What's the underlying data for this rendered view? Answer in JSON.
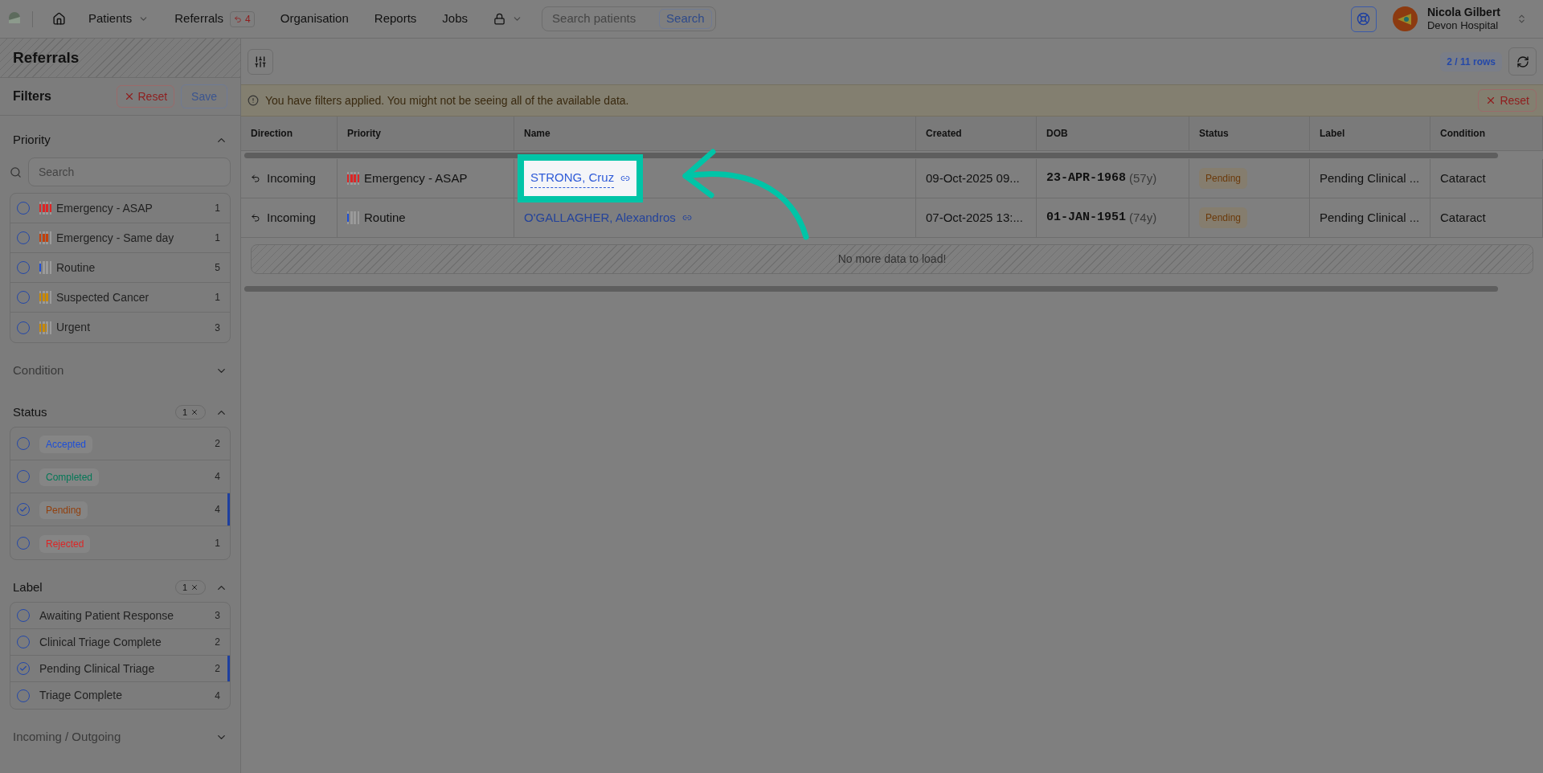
{
  "nav": {
    "items": [
      {
        "kind": "home"
      },
      {
        "kind": "dropdown",
        "label": "Patients"
      },
      {
        "kind": "badge",
        "label": "Referrals",
        "badge": "4"
      },
      {
        "kind": "link",
        "label": "Organisation"
      },
      {
        "kind": "link",
        "label": "Reports"
      },
      {
        "kind": "link",
        "label": "Jobs"
      },
      {
        "kind": "lock"
      }
    ],
    "search": {
      "placeholder": "Search patients",
      "button": "Search"
    },
    "user": {
      "name": "Nicola Gilbert",
      "org": "Devon Hospital"
    }
  },
  "sidebar": {
    "title": "Referrals",
    "filters_heading": "Filters",
    "reset": "Reset",
    "save": "Save",
    "sections": [
      {
        "title": "Priority",
        "expanded": true,
        "search_placeholder": "Search",
        "kind": "priority",
        "options": [
          {
            "label": "Emergency - ASAP",
            "count": "1",
            "checked": false,
            "color": "#dc2626",
            "level": 1
          },
          {
            "label": "Emergency - Same day",
            "count": "1",
            "checked": false,
            "color": "#c2410c",
            "level": 0.75
          },
          {
            "label": "Routine",
            "count": "5",
            "checked": false,
            "color": "#1d4ed8",
            "level": 0.25
          },
          {
            "label": "Suspected Cancer",
            "count": "1",
            "checked": false,
            "color": "#ca8a04",
            "level": 0.75
          },
          {
            "label": "Urgent",
            "count": "3",
            "checked": false,
            "color": "#ca8a04",
            "level": 0.5
          }
        ]
      },
      {
        "title": "Condition",
        "expanded": false
      },
      {
        "title": "Status",
        "expanded": true,
        "badge": "1",
        "kind": "status",
        "options": [
          {
            "label": "Accepted",
            "count": "2",
            "checked": false,
            "color": "#1d4ed8"
          },
          {
            "label": "Completed",
            "count": "4",
            "checked": false,
            "color": "#047857"
          },
          {
            "label": "Pending",
            "count": "4",
            "checked": true,
            "color": "#92400e"
          },
          {
            "label": "Rejected",
            "count": "1",
            "checked": false,
            "color": "#dc2626"
          }
        ]
      },
      {
        "title": "Label",
        "expanded": true,
        "badge": "1",
        "kind": "plain",
        "options": [
          {
            "label": "Awaiting Patient Response",
            "count": "3",
            "checked": false
          },
          {
            "label": "Clinical Triage Complete",
            "count": "2",
            "checked": false
          },
          {
            "label": "Pending Clinical Triage",
            "count": "2",
            "checked": true
          },
          {
            "label": "Triage Complete",
            "count": "4",
            "checked": false
          }
        ]
      },
      {
        "title": "Incoming / Outgoing",
        "expanded": false
      }
    ]
  },
  "toolbar": {
    "rows": "2 / 11 rows"
  },
  "banner": {
    "text": "You have filters applied. You might not be seeing all of the available data.",
    "reset": "Reset"
  },
  "table": {
    "columns": [
      "Direction",
      "Priority",
      "Name",
      "Created",
      "DOB",
      "Status",
      "Label",
      "Condition"
    ],
    "rows": [
      {
        "highlighted": true,
        "direction": "Incoming",
        "priority": {
          "label": "Emergency - ASAP",
          "color": "#dc2626",
          "level": 1
        },
        "name": "STRONG, Cruz",
        "created": "09-Oct-2025 09...",
        "dob": "23-APR-1968",
        "age": "(57y)",
        "status": "Pending",
        "label": "Pending Clinical ...",
        "condition": "Cataract"
      },
      {
        "highlighted": false,
        "direction": "Incoming",
        "priority": {
          "label": "Routine",
          "color": "#1d4ed8",
          "level": 0.25
        },
        "name": "O'GALLAGHER, Alexandros",
        "created": "07-Oct-2025 13:...",
        "dob": "01-JAN-1951",
        "age": "(74y)",
        "status": "Pending",
        "label": "Pending Clinical ...",
        "condition": "Cataract"
      }
    ],
    "footer": "No more data to load!"
  }
}
